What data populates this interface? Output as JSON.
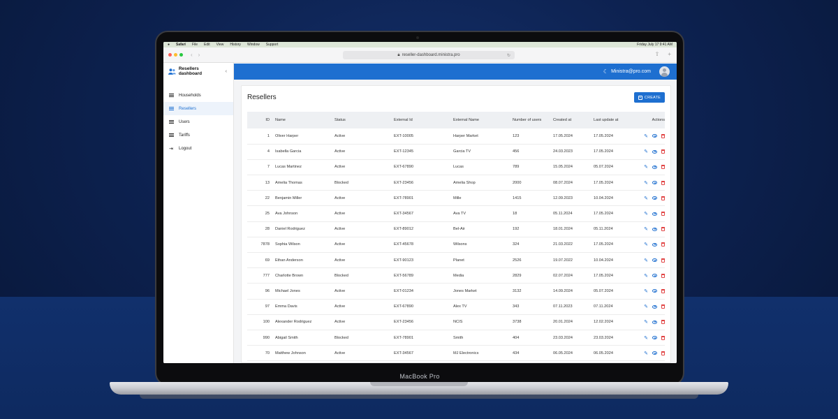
{
  "menubar": {
    "apple": "",
    "app": "Safari",
    "items": [
      "File",
      "Edit",
      "View",
      "History",
      "Window",
      "Support"
    ],
    "clock": "Friday July 17  9:41 AM"
  },
  "browser": {
    "url": "reseller-dashboard.ministra.pro",
    "lock_icon": "lock-icon"
  },
  "sidebar": {
    "title": "Resellers dashboard",
    "items": [
      {
        "label": "Households"
      },
      {
        "label": "Resellers"
      },
      {
        "label": "Users"
      },
      {
        "label": "Tariffs"
      },
      {
        "label": "Logout"
      }
    ]
  },
  "topbar": {
    "user": "Ministra@pro.com"
  },
  "page": {
    "title": "Resellers",
    "create_label": "CREATE"
  },
  "table": {
    "headers": [
      "ID",
      "Name",
      "Status",
      "External Id",
      "External Name",
      "Number of users",
      "Created at",
      "Last update at",
      "Actions"
    ],
    "rows": [
      [
        "1",
        "Oliver Harper",
        "Active",
        "EXT-10005",
        "Harper Market",
        "123",
        "17.05.2024",
        "17.05.2024"
      ],
      [
        "4",
        "Isabella Garcia",
        "Active",
        "EXT-12345",
        "Garcia TV",
        "456",
        "24.03.2023",
        "17.05.2024"
      ],
      [
        "7",
        "Lucas Martinez",
        "Active",
        "EXT-67890",
        "Lucas",
        "789",
        "15.05.2024",
        "05.07.2024"
      ],
      [
        "13",
        "Amelia Thomas",
        "Blocked",
        "EXT-23456",
        "Amelia Shop",
        "2000",
        "08.07.2024",
        "17.05.2024"
      ],
      [
        "22",
        "Benjamin Miller",
        "Active",
        "EXT-78901",
        "Mille",
        "1415",
        "12.09.2023",
        "10.04.2024"
      ],
      [
        "25",
        "Ava Johnson",
        "Active",
        "EXT-34567",
        "Ava TV",
        "18",
        "05.11.2024",
        "17.05.2024"
      ],
      [
        "28",
        "Daniel Rodriguez",
        "Active",
        "EXT-89012",
        "Bel-Air",
        "192",
        "18.01.2024",
        "05.11.2024"
      ],
      [
        "7878",
        "Sophia Wilson",
        "Active",
        "EXT-45678",
        "Wilsons",
        "324",
        "21.03.2022",
        "17.05.2024"
      ],
      [
        "69",
        "Ethan Anderson",
        "Active",
        "EXT-90123",
        "Planet",
        "2526",
        "19.07.2022",
        "10.04.2024"
      ],
      [
        "777",
        "Charlotte Brown",
        "Blocked",
        "EXT-56789",
        "Media",
        "2829",
        "02.07.2024",
        "17.05.2024"
      ],
      [
        "96",
        "Michael Jones",
        "Active",
        "EXT-01234",
        "Jones Market",
        "3132",
        "14.09.2024",
        "05.07.2024"
      ],
      [
        "97",
        "Emma Davis",
        "Active",
        "EXT-67890",
        "Alex TV",
        "343",
        "07.11.2023",
        "07.11.2024"
      ],
      [
        "100",
        "Alexander Rodriguez",
        "Active",
        "EXT-23456",
        "NCIS",
        "3738",
        "20.01.2024",
        "12.02.2024"
      ],
      [
        "990",
        "Abigail Smith",
        "Blocked",
        "EXT-78901",
        "Smith",
        "404",
        "23.03.2024",
        "23.03.2024"
      ],
      [
        "70",
        "Matthew Johnson",
        "Active",
        "EXT-34567",
        "MJ Electronics",
        "434",
        "06.05.2024",
        "06.05.2024"
      ]
    ]
  },
  "device": {
    "label": "MacBook Pro"
  },
  "colors": {
    "accent": "#1e6fd0",
    "danger": "#e14545",
    "traffic": [
      "#ff5f57",
      "#febc2e",
      "#28c840"
    ]
  }
}
